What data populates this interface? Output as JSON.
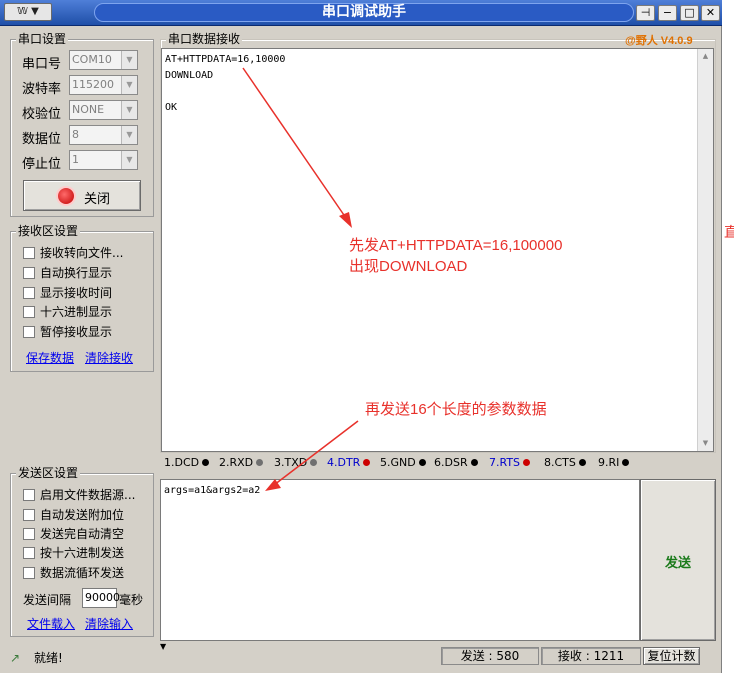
{
  "window": {
    "title": "串口调试助手",
    "version": "@野人 V4.0.9",
    "menu_btn": "▼"
  },
  "serial_settings": {
    "title": "串口设置",
    "fields": [
      {
        "label": "串口号",
        "value": "COM10"
      },
      {
        "label": "波特率",
        "value": "115200"
      },
      {
        "label": "校验位",
        "value": "NONE"
      },
      {
        "label": "数据位",
        "value": "8"
      },
      {
        "label": "停止位",
        "value": "1"
      }
    ],
    "close_button": "关闭"
  },
  "receive_settings": {
    "title": "接收区设置",
    "options": [
      "接收转向文件...",
      "自动换行显示",
      "显示接收时间",
      "十六进制显示",
      "暂停接收显示"
    ],
    "save_link": "保存数据",
    "clear_link": "清除接收"
  },
  "receive_area": {
    "title": "串口数据接收",
    "text": "AT+HTTPDATA=16,10000\nDOWNLOAD\n\nOK"
  },
  "signals": [
    {
      "label": "1.DCD",
      "color": "#000000",
      "dot": "#000000"
    },
    {
      "label": "2.RXD",
      "color": "#000000",
      "dot": "#707070"
    },
    {
      "label": "3.TXD",
      "color": "#000000",
      "dot": "#707070"
    },
    {
      "label": "4.DTR",
      "color": "#0000cc",
      "dot": "#cc0000"
    },
    {
      "label": "5.GND",
      "color": "#000000",
      "dot": "#000000"
    },
    {
      "label": "6.DSR",
      "color": "#000000",
      "dot": "#000000"
    },
    {
      "label": "7.RTS",
      "color": "#0000cc",
      "dot": "#cc0000"
    },
    {
      "label": "8.CTS",
      "color": "#000000",
      "dot": "#000000"
    },
    {
      "label": "9.RI",
      "color": "#000000",
      "dot": "#000000"
    }
  ],
  "send_settings": {
    "title": "发送区设置",
    "options": [
      "启用文件数据源...",
      "自动发送附加位",
      "发送完自动清空",
      "按十六进制发送",
      "数据流循环发送"
    ],
    "interval_label": "发送间隔",
    "interval_value": "90000",
    "interval_unit": "毫秒",
    "load_link": "文件载入",
    "clear_link": "清除输入"
  },
  "send_area": {
    "text": "args=a1&args2=a2",
    "send_button": "发送"
  },
  "status_bar": {
    "ready": "就绪!",
    "sent": "发送 : 580",
    "received": "接收 : 1211",
    "reset": "复位计数"
  },
  "annotations": {
    "first_line1": "先发AT+HTTPDATA=16,100000",
    "first_line2": "出现DOWNLOAD",
    "second": "再发送16个长度的参数数据",
    "edge_char": "直"
  },
  "colors": {
    "annotation": "#e8312b",
    "send_button_text": "#1a7a1a",
    "version": "#e07000",
    "link": "#0000ee"
  }
}
